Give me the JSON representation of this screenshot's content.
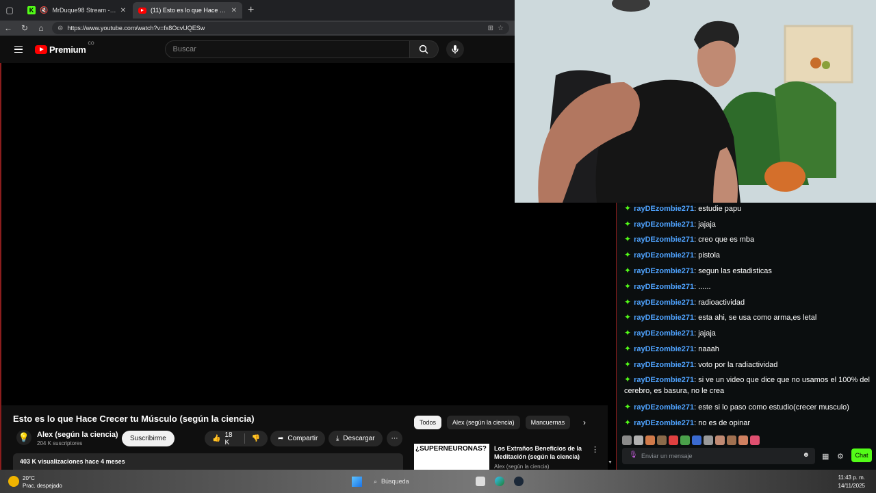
{
  "browser": {
    "tabs": [
      {
        "title": "MrDuque98 Stream - Kick D…",
        "favicon": "kick-icon",
        "active": false
      },
      {
        "title": "(11) Esto es lo que Hace Crecer tu …",
        "favicon": "youtube-icon",
        "active": true
      }
    ],
    "url": "https://www.youtube.com/watch?v=fx8OcvUQESw"
  },
  "youtube": {
    "brand": "Premium",
    "country": "CO",
    "search_placeholder": "Buscar",
    "video": {
      "title": "Esto es lo que Hace Crecer tu Músculo (según la ciencia)",
      "channel": "Alex (según la ciencia)",
      "subscribers": "204 K suscriptores",
      "subscribe_label": "Suscribirme",
      "likes": "18 K",
      "share_label": "Compartir",
      "download_label": "Descargar",
      "views": "403 K visualizaciones  hace 4 meses"
    },
    "chips": [
      "Todos",
      "Alex (según la ciencia)",
      "Mancuernas"
    ],
    "recommendation": {
      "thumb_text": "¿SUPERNEURONAS?",
      "title": "Los Extraños Beneficios de la Meditación (según la ciencia)",
      "channel": "Alex (según la ciencia)"
    }
  },
  "chat": {
    "messages": [
      {
        "user": "rayDEzombie271",
        "text": "estudie papu"
      },
      {
        "user": "rayDEzombie271",
        "text": "jajaja"
      },
      {
        "user": "rayDEzombie271",
        "text": "creo que es mba"
      },
      {
        "user": "rayDEzombie271",
        "text": "pistola"
      },
      {
        "user": "rayDEzombie271",
        "text": "segun las estadisticas"
      },
      {
        "user": "rayDEzombie271",
        "text": "......"
      },
      {
        "user": "rayDEzombie271",
        "text": "radioactividad"
      },
      {
        "user": "rayDEzombie271",
        "text": "esta ahi, se usa como arma,es letal"
      },
      {
        "user": "rayDEzombie271",
        "text": "jajaja"
      },
      {
        "user": "rayDEzombie271",
        "text": "naaah"
      },
      {
        "user": "rayDEzombie271",
        "text": "voto por la radiactividad"
      },
      {
        "user": "rayDEzombie271",
        "text": "si ve un video que dice que no usamos el 100% del cerebro, es basura, no le crea"
      },
      {
        "user": "rayDEzombie271",
        "text": "este si lo paso como estudio(crecer musculo)"
      },
      {
        "user": "rayDEzombie271",
        "text": "no es de opinar"
      }
    ],
    "input_placeholder": "Enviar un mensaje",
    "send_label": "Chat"
  },
  "taskbar": {
    "temperature": "20°C",
    "condition": "Prac. despejado",
    "search_label": "Búsqueda",
    "time": "11:43 p. m.",
    "date": "14/11/2025"
  },
  "colors": {
    "accent_kick": "#53fc18",
    "youtube_red": "#ff0000",
    "chat_user": "#4fa3ff"
  }
}
